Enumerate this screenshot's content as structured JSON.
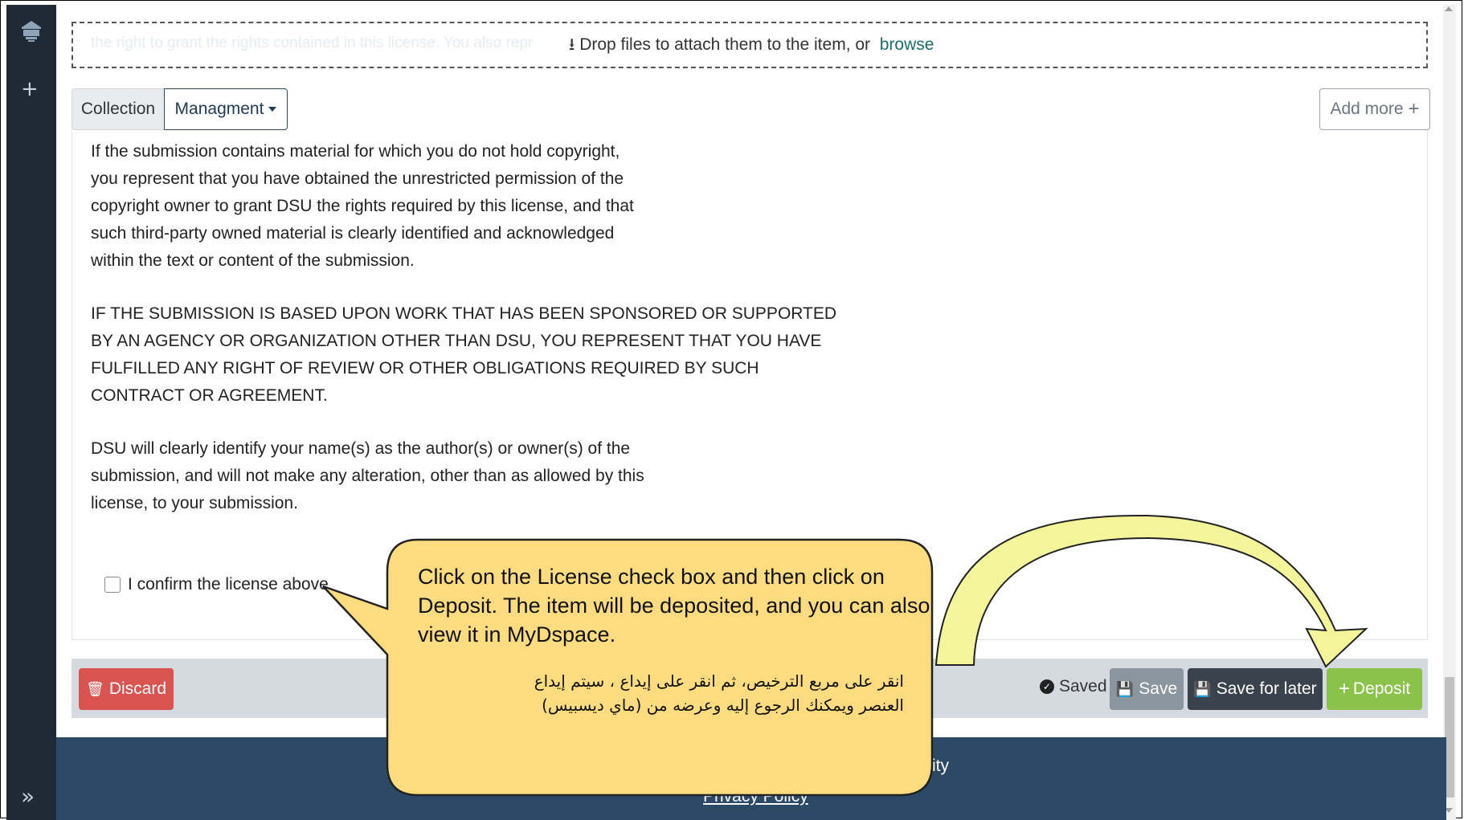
{
  "dropzone": {
    "text": "Drop files to attach them to the item, or",
    "browse_label": "browse",
    "ghost_line_1": "the right to grant the rights contained in this license. You also repr"
  },
  "tabs": {
    "collection_label": "Collection",
    "managment_label": "Managment",
    "add_more_label": "Add more"
  },
  "license": {
    "paragraph_1": [
      "If the submission contains material for which you do not hold copyright,",
      "you represent that you have obtained the unrestricted permission of the",
      "copyright owner to grant DSU the rights required by this license, and that",
      "such third-party owned material is clearly identified and acknowledged",
      "within the text or content of the submission."
    ],
    "paragraph_2": [
      "IF THE SUBMISSION IS BASED UPON WORK THAT HAS BEEN SPONSORED OR SUPPORTED",
      "BY AN AGENCY OR ORGANIZATION OTHER THAN DSU, YOU REPRESENT THAT YOU HAVE",
      "FULFILLED ANY RIGHT OF REVIEW OR OTHER OBLIGATIONS REQUIRED BY SUCH",
      "CONTRACT OR AGREEMENT."
    ],
    "paragraph_3": [
      "DSU will clearly identify your name(s) as the author(s) or owner(s) of the",
      "submission, and will not make any alteration, other than as allowed by this",
      "license, to your submission."
    ],
    "confirm_label": "I confirm the license above"
  },
  "actions": {
    "discard_label": "Discard",
    "saved_label": "Saved",
    "save_label": "Save",
    "save_for_later_label": "Save for later",
    "deposit_label": "Deposit"
  },
  "footer": {
    "text_fragment": "ity",
    "privacy_link": "Privacy Policy"
  },
  "callout": {
    "english": "Click on the License check box and then click on Deposit. The item will be deposited, and you can also view it in MyDspace.",
    "arabic_line_1": "انقر على مربع الترخيص، ثم انقر على إيداع ، سيتم إيداع",
    "arabic_line_2": "العنصر ويمكنك الرجوع إليه وعرضه من (ماي ديسبيس)"
  },
  "colors": {
    "sidebar": "#1e2a36",
    "footer": "#2c4a66",
    "discard": "#d9534f",
    "deposit": "#8bc34a",
    "callout_fill": "#fddc80",
    "arrow_fill": "#f4f49a"
  }
}
